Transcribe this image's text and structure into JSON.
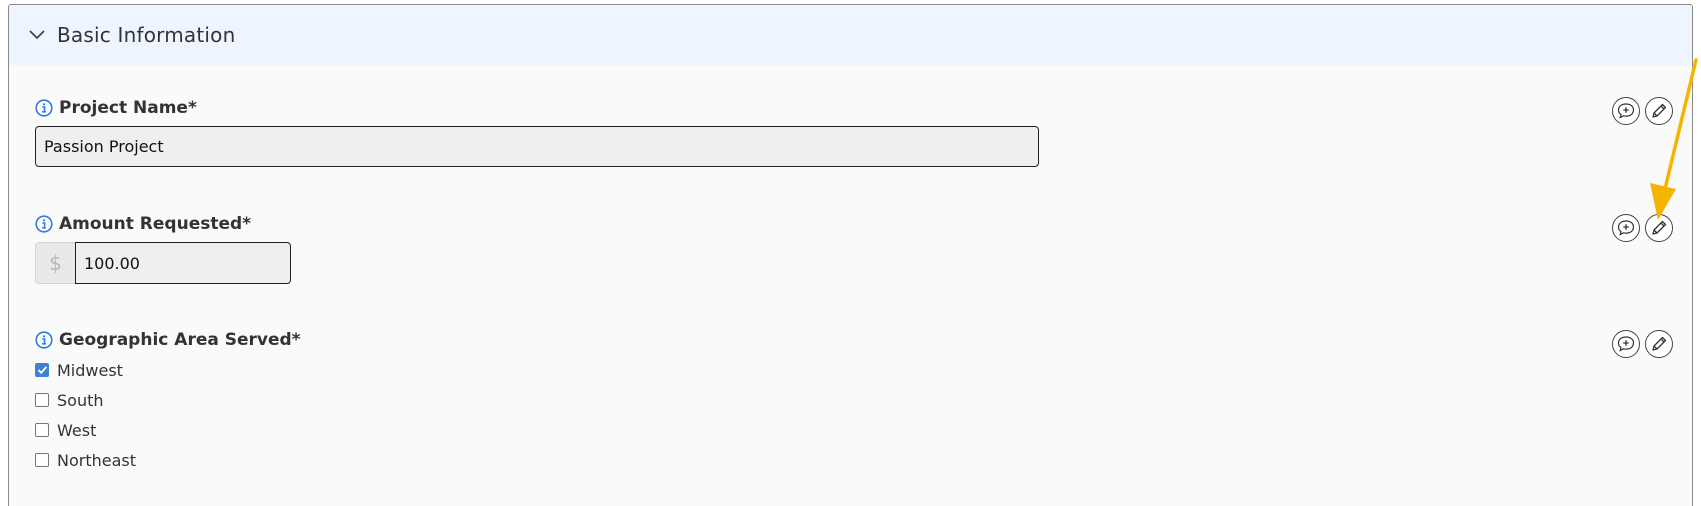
{
  "section": {
    "title": "Basic Information",
    "expanded": true
  },
  "fields": {
    "project_name": {
      "label": "Project Name*",
      "value": "Passion Project"
    },
    "amount_requested": {
      "label": "Amount Requested*",
      "currency_symbol": "$",
      "value": "100.00"
    },
    "geographic_area": {
      "label": "Geographic Area Served*",
      "options": [
        {
          "label": "Midwest",
          "checked": true
        },
        {
          "label": "South",
          "checked": false
        },
        {
          "label": "West",
          "checked": false
        },
        {
          "label": "Northeast",
          "checked": false
        }
      ]
    }
  },
  "icons": {
    "section_toggle": "chevron-down-icon",
    "field_info": "info-icon",
    "add_comment": "comment-plus-icon",
    "edit": "pencil-icon"
  },
  "colors": {
    "header_bg": "#eef5ff",
    "info_blue": "#2e7de0",
    "checkbox_checked": "#3b82d6",
    "annotation_arrow": "#f5b400"
  }
}
